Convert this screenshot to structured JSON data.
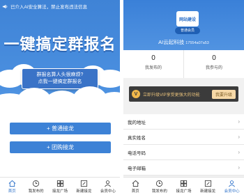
{
  "left": {
    "notice": "已介入AI安全算法，禁止发布违法信息",
    "headline": "一键搞定群报名",
    "task_line1": "群报名算人头很麻烦?",
    "task_line2": "点我一键搞定群报名",
    "buttons": [
      {
        "label": "+ 普通接龙"
      },
      {
        "label": "+ 团购接龙"
      }
    ]
  },
  "right": {
    "logo_text": "网站建设",
    "member_badge": "普通会员",
    "username": "AI云起科技",
    "user_id": "17554a07a53",
    "stats": [
      {
        "value": "0",
        "label": "我发布的"
      },
      {
        "value": "0",
        "label": "我参与的"
      }
    ],
    "vip": {
      "icon": "V",
      "text": "立即升级VIP享受更强大的功能",
      "button": "我要升级"
    },
    "list": [
      {
        "label": "我的地址"
      },
      {
        "label": "真实姓名"
      },
      {
        "label": "电话号码"
      },
      {
        "label": "电子邮箱"
      }
    ]
  },
  "tabbar": {
    "tabs": [
      {
        "label": "首页",
        "icon": "home-icon"
      },
      {
        "label": "我发布的",
        "icon": "clock-icon"
      },
      {
        "label": "接龙广场",
        "icon": "grid-icon"
      },
      {
        "label": "新建接龙",
        "icon": "edit-icon"
      },
      {
        "label": "会员中心",
        "icon": "user-icon"
      }
    ]
  },
  "colors": {
    "primary": "#3d82d6",
    "vip_dark": "#3b3b3b",
    "vip_gold": "#f7d9a8"
  }
}
